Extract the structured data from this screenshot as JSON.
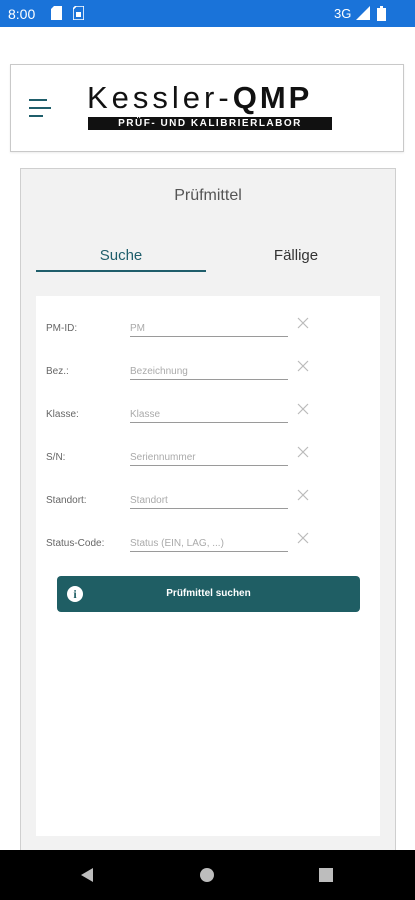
{
  "status_bar": {
    "time": "8:00",
    "network": "3G"
  },
  "header": {
    "logo_main_prefix": "Kessler-",
    "logo_main_bold": "QMP",
    "logo_sub": "PRÜF- UND KALIBRIERLABOR"
  },
  "page": {
    "title": "Prüfmittel"
  },
  "tabs": [
    {
      "label": "Suche",
      "active": true
    },
    {
      "label": "Fällige",
      "active": false
    }
  ],
  "form": {
    "fields": [
      {
        "label": "PM-ID:",
        "placeholder": "PM",
        "value": ""
      },
      {
        "label": "Bez.:",
        "placeholder": "Bezeichnung",
        "value": ""
      },
      {
        "label": "Klasse:",
        "placeholder": "Klasse",
        "value": ""
      },
      {
        "label": "S/N:",
        "placeholder": "Seriennummer",
        "value": ""
      },
      {
        "label": "Standort:",
        "placeholder": "Standort",
        "value": ""
      },
      {
        "label": "Status-Code:",
        "placeholder": "Status (EIN, LAG, ...)",
        "value": ""
      }
    ],
    "search_button": "Prüfmittel suchen"
  },
  "colors": {
    "status_bar": "#1a73d9",
    "accent": "#1f5e64",
    "nav_bar": "#000000"
  },
  "icons": [
    "sd-card-icon",
    "sim-card-icon",
    "signal-icon",
    "battery-icon",
    "menu-icon",
    "clear-icon",
    "info-icon",
    "back-icon",
    "home-icon",
    "recents-icon"
  ]
}
